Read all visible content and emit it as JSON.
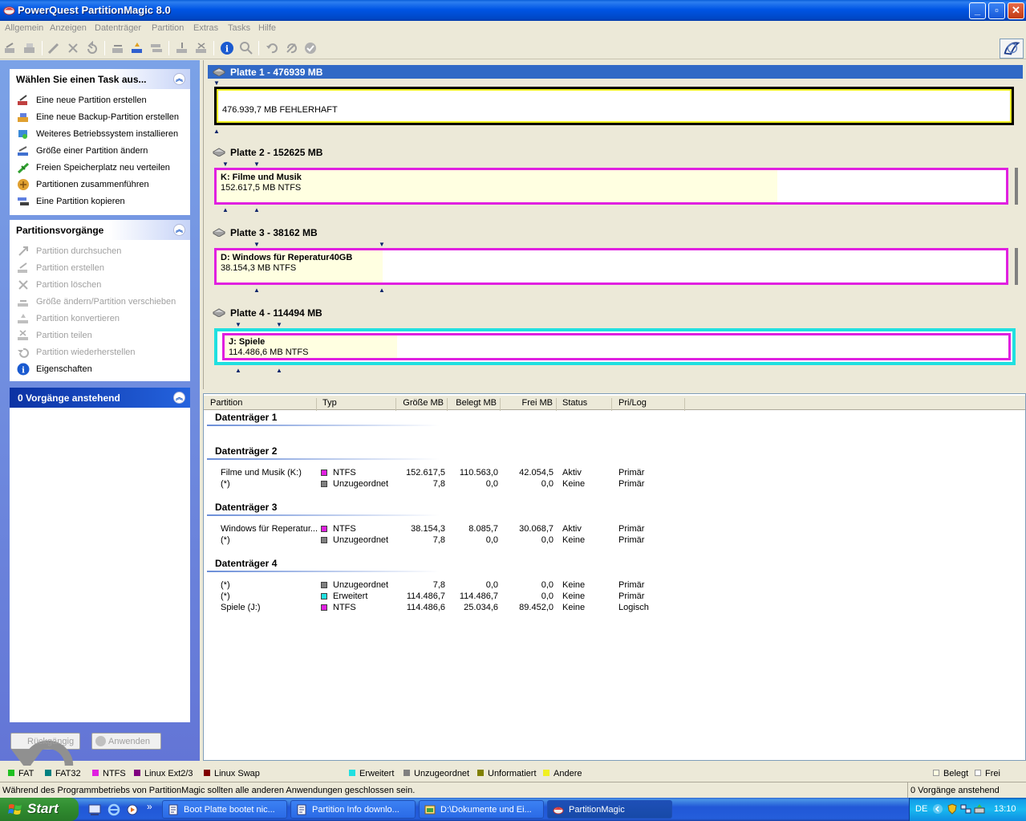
{
  "window": {
    "title": "PowerQuest PartitionMagic 8.0"
  },
  "menu": [
    "Allgemein",
    "Anzeigen",
    "Datenträger",
    "Partition",
    "Extras",
    "Tasks",
    "Hilfe"
  ],
  "tasks_panel": {
    "title": "Wählen Sie einen Task aus...",
    "items": [
      "Eine neue Partition erstellen",
      "Eine neue Backup-Partition erstellen",
      "Weiteres Betriebssystem installieren",
      "Größe einer Partition ändern",
      "Freien Speicherplatz neu verteilen",
      "Partitionen zusammenführen",
      "Eine Partition kopieren"
    ]
  },
  "ops_panel": {
    "title": "Partitionsvorgänge",
    "items": [
      "Partition durchsuchen",
      "Partition erstellen",
      "Partition löschen",
      "Größe ändern/Partition verschieben",
      "Partition konvertieren",
      "Partition teilen",
      "Partition wiederherstellen",
      "Eigenschaften"
    ]
  },
  "pending_panel": {
    "title": "0 Vorgänge anstehend"
  },
  "buttons": {
    "undo": "Rückgängig",
    "apply": "Anwenden"
  },
  "disks": [
    {
      "title": "Platte 1 - 476939 MB",
      "name": "",
      "info": "476.939,7 MB    FEHLERHAFT"
    },
    {
      "title": "Platte 2 - 152625 MB",
      "name": "K:  Filme und Musik",
      "info": "152.617,5 MB    NTFS"
    },
    {
      "title": "Platte 3 - 38162 MB",
      "name": "D:  Windows für Reperatur40GB",
      "info": "38.154,3 MB    NTFS"
    },
    {
      "title": "Platte 4 - 114494 MB",
      "name": "J:  Spiele",
      "info": "114.486,6 MB    NTFS"
    }
  ],
  "table": {
    "columns": [
      "Partition",
      "Typ",
      "Größe MB",
      "Belegt MB",
      "Frei MB",
      "Status",
      "Pri/Log"
    ],
    "groups": [
      {
        "title": "Datenträger 1",
        "rows": []
      },
      {
        "title": "Datenträger 2",
        "rows": [
          {
            "partition": "Filme und Musik (K:)",
            "type": "NTFS",
            "color": "#e020e0",
            "size": "152.617,5",
            "used": "110.563,0",
            "free": "42.054,5",
            "status": "Aktiv",
            "prilog": "Primär"
          },
          {
            "partition": "(*)",
            "type": "Unzugeordnet",
            "color": "#808080",
            "size": "7,8",
            "used": "0,0",
            "free": "0,0",
            "status": "Keine",
            "prilog": "Primär"
          }
        ]
      },
      {
        "title": "Datenträger 3",
        "rows": [
          {
            "partition": "Windows für Reperatur...",
            "type": "NTFS",
            "color": "#e020e0",
            "size": "38.154,3",
            "used": "8.085,7",
            "free": "30.068,7",
            "status": "Aktiv",
            "prilog": "Primär"
          },
          {
            "partition": "(*)",
            "type": "Unzugeordnet",
            "color": "#808080",
            "size": "7,8",
            "used": "0,0",
            "free": "0,0",
            "status": "Keine",
            "prilog": "Primär"
          }
        ]
      },
      {
        "title": "Datenträger 4",
        "rows": [
          {
            "partition": "(*)",
            "type": "Unzugeordnet",
            "color": "#808080",
            "size": "7,8",
            "used": "0,0",
            "free": "0,0",
            "status": "Keine",
            "prilog": "Primär"
          },
          {
            "partition": "(*)",
            "type": "Erweitert",
            "color": "#20e0e0",
            "size": "114.486,7",
            "used": "114.486,7",
            "free": "0,0",
            "status": "Keine",
            "prilog": "Primär"
          },
          {
            "partition": "Spiele (J:)",
            "type": "NTFS",
            "color": "#e020e0",
            "size": "114.486,6",
            "used": "25.034,6",
            "free": "89.452,0",
            "status": "Keine",
            "prilog": "Logisch"
          }
        ]
      }
    ]
  },
  "legend": [
    {
      "label": "FAT",
      "color": "#20c020"
    },
    {
      "label": "FAT32",
      "color": "#008080"
    },
    {
      "label": "NTFS",
      "color": "#e020e0"
    },
    {
      "label": "Linux Ext2/3",
      "color": "#800080"
    },
    {
      "label": "Linux Swap",
      "color": "#800000"
    },
    {
      "label": "Erweitert",
      "color": "#20e0e0"
    },
    {
      "label": "Unzugeordnet",
      "color": "#808080"
    },
    {
      "label": "Unformatiert",
      "color": "#808000"
    },
    {
      "label": "Andere",
      "color": "#f0f020"
    },
    {
      "label": "Belegt",
      "color": "#ffffe1"
    },
    {
      "label": "Frei",
      "color": "#ffffff"
    }
  ],
  "status": {
    "message": "Während des Programmbetriebs von PartitionMagic sollten alle anderen Anwendungen geschlossen sein.",
    "pending": "0 Vorgänge anstehend"
  },
  "taskbar": {
    "start": "Start",
    "overflow": "»",
    "items": [
      "Boot Platte bootet nic...",
      "Partition Info downlo...",
      "D:\\Dokumente und Ei...",
      "PartitionMagic"
    ],
    "lang": "DE",
    "clock": "13:10"
  }
}
